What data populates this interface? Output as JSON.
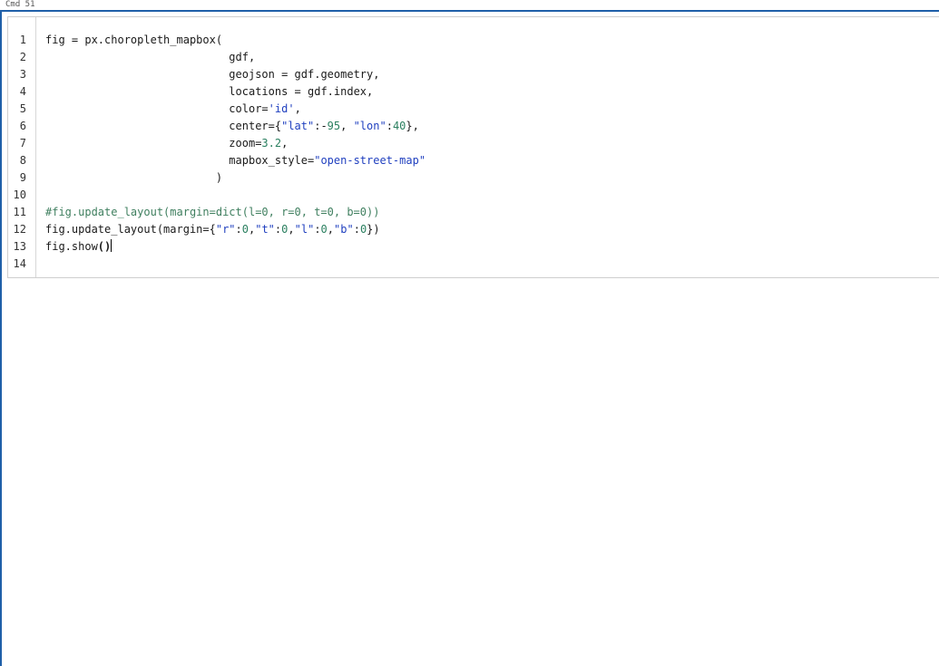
{
  "header": {
    "label": "Cmd 51"
  },
  "cell": {
    "line_numbers": [
      "1",
      "2",
      "3",
      "4",
      "5",
      "6",
      "7",
      "8",
      "9",
      "10",
      "11",
      "12",
      "13",
      "14"
    ],
    "lines": [
      {
        "indent": "",
        "tokens": [
          {
            "t": "plain",
            "v": "fig = px.choropleth_mapbox("
          }
        ]
      },
      {
        "indent": "                            ",
        "tokens": [
          {
            "t": "plain",
            "v": "gdf,"
          }
        ]
      },
      {
        "indent": "                            ",
        "tokens": [
          {
            "t": "plain",
            "v": "geojson = gdf.geometry,"
          }
        ]
      },
      {
        "indent": "                            ",
        "tokens": [
          {
            "t": "plain",
            "v": "locations = gdf.index,"
          }
        ]
      },
      {
        "indent": "                            ",
        "tokens": [
          {
            "t": "plain",
            "v": "color="
          },
          {
            "t": "str",
            "v": "'id'"
          },
          {
            "t": "plain",
            "v": ","
          }
        ]
      },
      {
        "indent": "                            ",
        "tokens": [
          {
            "t": "plain",
            "v": "center={"
          },
          {
            "t": "str",
            "v": "\"lat\""
          },
          {
            "t": "plain",
            "v": ":-"
          },
          {
            "t": "num",
            "v": "95"
          },
          {
            "t": "plain",
            "v": ", "
          },
          {
            "t": "str",
            "v": "\"lon\""
          },
          {
            "t": "plain",
            "v": ":"
          },
          {
            "t": "num",
            "v": "40"
          },
          {
            "t": "plain",
            "v": "},"
          }
        ]
      },
      {
        "indent": "                            ",
        "tokens": [
          {
            "t": "plain",
            "v": "zoom="
          },
          {
            "t": "num",
            "v": "3.2"
          },
          {
            "t": "plain",
            "v": ","
          }
        ]
      },
      {
        "indent": "                            ",
        "tokens": [
          {
            "t": "plain",
            "v": "mapbox_style="
          },
          {
            "t": "str",
            "v": "\"open-street-map\""
          }
        ]
      },
      {
        "indent": "                          ",
        "tokens": [
          {
            "t": "plain",
            "v": ")"
          }
        ]
      },
      {
        "indent": "",
        "tokens": []
      },
      {
        "indent": "",
        "tokens": [
          {
            "t": "cmt",
            "v": "#fig.update_layout(margin=dict(l=0, r=0, t=0, b=0))"
          }
        ]
      },
      {
        "indent": "",
        "tokens": [
          {
            "t": "plain",
            "v": "fig.update_layout(margin={"
          },
          {
            "t": "str",
            "v": "\"r\""
          },
          {
            "t": "plain",
            "v": ":"
          },
          {
            "t": "num",
            "v": "0"
          },
          {
            "t": "plain",
            "v": ","
          },
          {
            "t": "str",
            "v": "\"t\""
          },
          {
            "t": "plain",
            "v": ":"
          },
          {
            "t": "num",
            "v": "0"
          },
          {
            "t": "plain",
            "v": ","
          },
          {
            "t": "str",
            "v": "\"l\""
          },
          {
            "t": "plain",
            "v": ":"
          },
          {
            "t": "num",
            "v": "0"
          },
          {
            "t": "plain",
            "v": ","
          },
          {
            "t": "str",
            "v": "\"b\""
          },
          {
            "t": "plain",
            "v": ":"
          },
          {
            "t": "num",
            "v": "0"
          },
          {
            "t": "plain",
            "v": "})"
          }
        ]
      },
      {
        "indent": "",
        "tokens": [
          {
            "t": "plain",
            "v": "fig.show"
          },
          {
            "t": "bold",
            "v": "()"
          },
          {
            "t": "cursor",
            "v": ""
          }
        ]
      },
      {
        "indent": "",
        "tokens": []
      }
    ]
  },
  "colors": {
    "frame_accent": "#1f5fa8",
    "string": "#1f3fbf",
    "comment": "#3f7f5f",
    "number": "#2a7f5f"
  }
}
